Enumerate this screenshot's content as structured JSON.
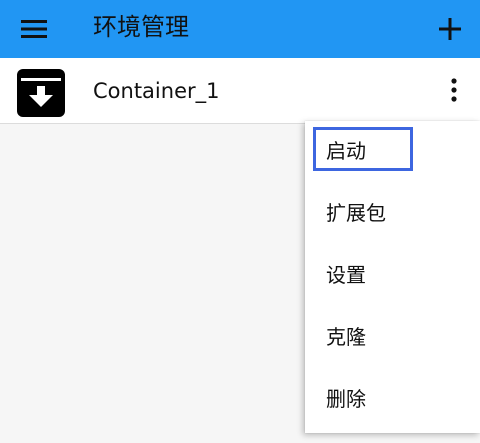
{
  "appbar": {
    "title": "环境管理",
    "color": "#2196f3",
    "menu_icon": "hamburger-menu-icon",
    "add_icon": "plus-icon"
  },
  "list": {
    "items": [
      {
        "label": "Container_1",
        "icon": "archive-download-icon",
        "more_icon": "more-vertical-icon"
      }
    ]
  },
  "popup_menu": {
    "items": [
      {
        "label": "启动",
        "selected": true
      },
      {
        "label": "扩展包"
      },
      {
        "label": "设置"
      },
      {
        "label": "克隆"
      },
      {
        "label": "删除"
      }
    ],
    "highlight_color": "#3d66e0"
  }
}
